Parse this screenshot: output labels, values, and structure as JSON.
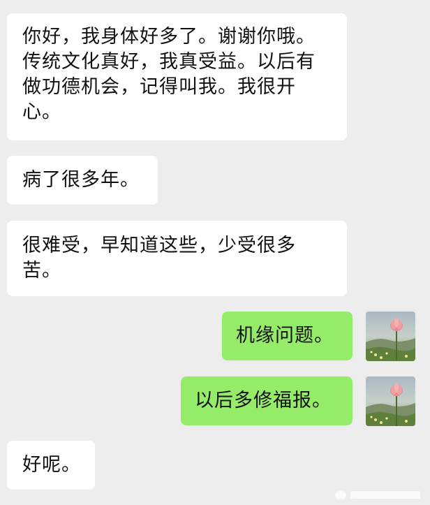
{
  "conversation": {
    "messages": [
      {
        "side": "incoming",
        "text": "你好，我身体好多了。谢谢你哦。传统文化真好，我真受益。以后有做功德机会，记得叫我。我很开心。"
      },
      {
        "side": "incoming",
        "text": "病了很多年。"
      },
      {
        "side": "incoming",
        "text": "很难受，早知道这些，少受很多苦。"
      },
      {
        "side": "outgoing",
        "text": "机缘问题。",
        "avatar": "lotus-flower-avatar"
      },
      {
        "side": "outgoing",
        "text": "以后多修福报。",
        "avatar": "lotus-flower-avatar"
      },
      {
        "side": "incoming",
        "text": "好呢。"
      }
    ]
  },
  "colors": {
    "background": "#ededed",
    "incoming_bubble": "#ffffff",
    "outgoing_bubble": "#95ec69",
    "text": "#111111"
  }
}
